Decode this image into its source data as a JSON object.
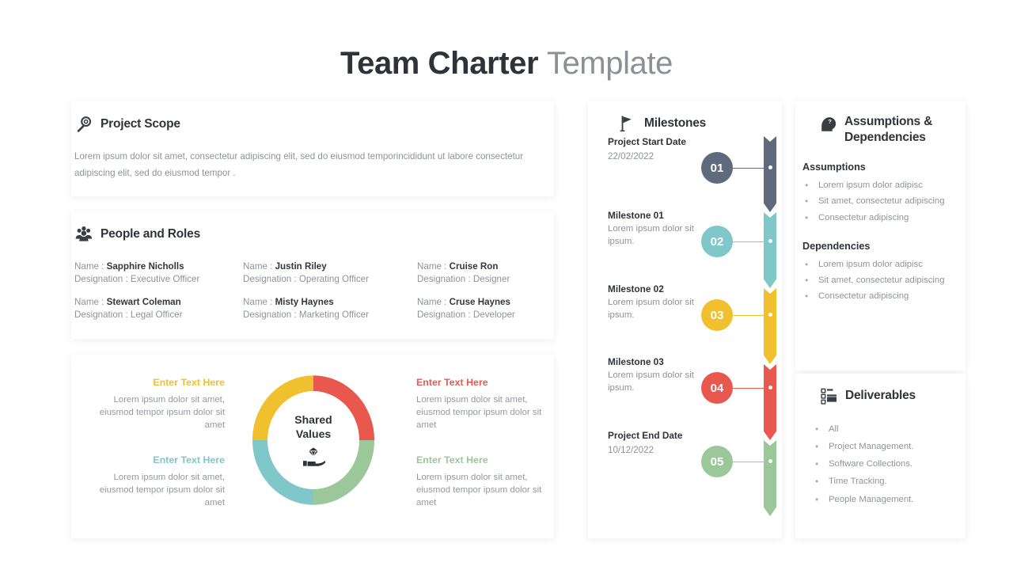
{
  "title": {
    "main": "Team Charter ",
    "sub": "Template"
  },
  "colors": {
    "yellow": "#F0C02E",
    "red": "#E9584F",
    "teal": "#7FC7C8",
    "green": "#9BC79B",
    "slate": "#5F6B7D",
    "heading": "#30333A",
    "muted": "#8E9399"
  },
  "project_scope": {
    "icon": "magnifier-icon",
    "title": "Project Scope",
    "body": "Lorem ipsum dolor sit amet, consectetur adipiscing elit, sed do eiusmod temporincididunt ut labore consectetur adipiscing elit, sed do eiusmod tempor ."
  },
  "people_and_roles": {
    "icon": "people-group-icon",
    "title": "People and Roles",
    "name_label": "Name :",
    "designation_label": "Designation :",
    "people": [
      {
        "name": "Sapphire  Nicholls",
        "designation": "Executive Officer"
      },
      {
        "name": "Justin Riley",
        "designation": "Operating  Officer"
      },
      {
        "name": "Cruise Ron",
        "designation": "Designer"
      },
      {
        "name": "Stewart Coleman",
        "designation": "Legal Officer"
      },
      {
        "name": "Misty Haynes",
        "designation": "Marketing  Officer"
      },
      {
        "name": "Cruse Haynes",
        "designation": "Developer"
      }
    ]
  },
  "shared_values": {
    "center_line1": "Shared",
    "center_line2": "Values",
    "center_icon": "diamond-in-hand-icon",
    "segments": [
      {
        "position": "top-left",
        "label": "Enter Text Here",
        "color": "#F0C02E",
        "text": "Lorem ipsum dolor sit amet, eiusmod tempor ipsum dolor sit amet"
      },
      {
        "position": "top-right",
        "label": "Enter Text Here",
        "color": "#E9584F",
        "text": "Lorem ipsum dolor sit amet, eiusmod tempor ipsum dolor sit amet"
      },
      {
        "position": "bottom-left",
        "label": "Enter Text Here",
        "color": "#7FC7C8",
        "text": "Lorem ipsum dolor sit amet, eiusmod tempor ipsum dolor sit amet"
      },
      {
        "position": "bottom-right",
        "label": "Enter Text Here",
        "color": "#9BC79B",
        "text": "Lorem ipsum dolor sit amet, eiusmod tempor ipsum dolor sit amet"
      }
    ]
  },
  "milestones": {
    "icon": "flag-icon",
    "title": "Milestones",
    "items": [
      {
        "number": "01",
        "title": "Project Start Date",
        "date": "22/02/2022",
        "desc": "",
        "color": "#5F6B7D"
      },
      {
        "number": "02",
        "title": "Milestone 01",
        "date": "",
        "desc": "Lorem ipsum dolor sit ipsum.",
        "color": "#7FC7C8"
      },
      {
        "number": "03",
        "title": "Milestone 02",
        "date": "",
        "desc": "Lorem ipsum dolor sit ipsum.",
        "color": "#F0C02E"
      },
      {
        "number": "04",
        "title": "Milestone 03",
        "date": "",
        "desc": "Lorem ipsum dolor sit ipsum.",
        "color": "#E9584F"
      },
      {
        "number": "05",
        "title": "Project End Date",
        "date": "10/12/2022",
        "desc": "",
        "color": "#9BC79B"
      }
    ]
  },
  "assumptions_dependencies": {
    "icon": "head-question-icon",
    "title_line1": "Assumptions &",
    "title_line2": "Dependencies",
    "assumptions_heading": "Assumptions",
    "assumptions": [
      "Lorem ipsum dolor adipisc",
      "Sit amet, consectetur adipiscing",
      "Consectetur adipiscing"
    ],
    "dependencies_heading": "Dependencies",
    "dependencies": [
      " Lorem ipsum dolor adipisc",
      "Sit amet, consectetur adipiscing",
      "Consectetur adipiscing"
    ]
  },
  "deliverables": {
    "icon": "checklist-icon",
    "title": "Deliverables",
    "items": [
      "All",
      "Project Management.",
      "Software Collections.",
      "Time Tracking.",
      "People Management."
    ]
  }
}
